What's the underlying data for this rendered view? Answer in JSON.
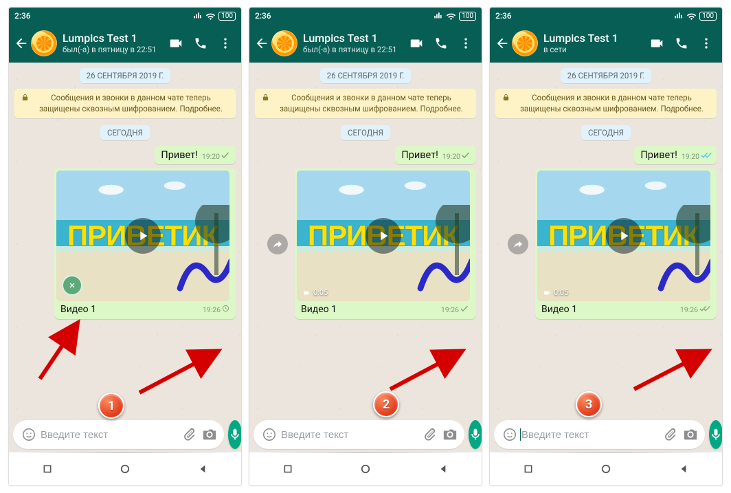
{
  "statusbar": {
    "time": "2:36",
    "battery": "100"
  },
  "header": {
    "contact_name": "Lumpics Test 1",
    "last_seen": "был(-а) в пятницу в 22:51",
    "online": "в сети"
  },
  "chat": {
    "date_chip": "26 СЕНТЯБРЯ 2019 Г.",
    "encryption_notice": "Сообщения и звонки в данном чате теперь защищены сквозным шифрованием. Подробнее.",
    "today_chip": "СЕГОДНЯ",
    "greeting": {
      "text": "Привет!",
      "time": "19:20"
    },
    "video": {
      "overlay_text": "ПРИВЕТИК",
      "caption": "Видео 1",
      "time": "19:26",
      "duration": "0:05"
    }
  },
  "input": {
    "placeholder": "Введите текст"
  },
  "annotations": {
    "step1": "1",
    "step2": "2",
    "step3": "3"
  }
}
